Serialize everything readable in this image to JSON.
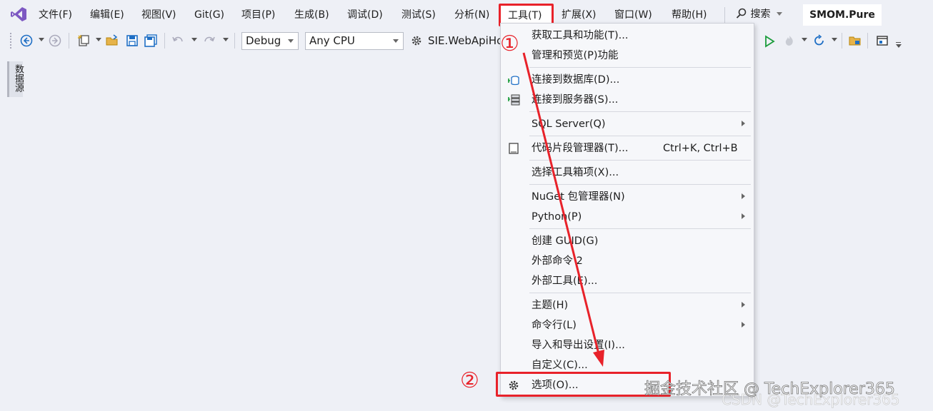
{
  "menubar": {
    "items": [
      "文件(F)",
      "编辑(E)",
      "视图(V)",
      "Git(G)",
      "项目(P)",
      "生成(B)",
      "调试(D)",
      "测试(S)",
      "分析(N)",
      "工具(T)",
      "扩展(X)",
      "窗口(W)",
      "帮助(H)"
    ],
    "search_label": "搜索",
    "solution_name": "SMOM.Pure"
  },
  "toolbar": {
    "configuration": "Debug",
    "platform": "Any CPU",
    "startup_project": "SIE.WebApiHost"
  },
  "side_panel": {
    "tab_label": "数据源"
  },
  "tools_menu": {
    "items": [
      {
        "label": "获取工具和功能(T)...",
        "shortcut": "",
        "submenu": false,
        "icon": ""
      },
      {
        "label": "管理和预览(P)功能",
        "shortcut": "",
        "submenu": false,
        "icon": ""
      },
      {
        "label": "连接到数据库(D)...",
        "shortcut": "",
        "submenu": false,
        "icon": "database-connect-icon"
      },
      {
        "label": "连接到服务器(S)...",
        "shortcut": "",
        "submenu": false,
        "icon": "server-connect-icon"
      },
      {
        "label": "SQL Server(Q)",
        "shortcut": "",
        "submenu": true,
        "icon": ""
      },
      {
        "label": "代码片段管理器(T)...",
        "shortcut": "Ctrl+K, Ctrl+B",
        "submenu": false,
        "icon": "snippet-manager-icon"
      },
      {
        "label": "选择工具箱项(X)...",
        "shortcut": "",
        "submenu": false,
        "icon": ""
      },
      {
        "label": "NuGet 包管理器(N)",
        "shortcut": "",
        "submenu": true,
        "icon": ""
      },
      {
        "label": "Python(P)",
        "shortcut": "",
        "submenu": true,
        "icon": ""
      },
      {
        "label": "创建 GUID(G)",
        "shortcut": "",
        "submenu": false,
        "icon": ""
      },
      {
        "label": "外部命令 2",
        "shortcut": "",
        "submenu": false,
        "icon": ""
      },
      {
        "label": "外部工具(E)...",
        "shortcut": "",
        "submenu": false,
        "icon": ""
      },
      {
        "label": "主题(H)",
        "shortcut": "",
        "submenu": true,
        "icon": ""
      },
      {
        "label": "命令行(L)",
        "shortcut": "",
        "submenu": true,
        "icon": ""
      },
      {
        "label": "导入和导出设置(I)...",
        "shortcut": "",
        "submenu": false,
        "icon": ""
      },
      {
        "label": "自定义(C)...",
        "shortcut": "",
        "submenu": false,
        "icon": ""
      },
      {
        "label": "选项(O)...",
        "shortcut": "",
        "submenu": false,
        "icon": "gear-icon"
      }
    ]
  },
  "annotations": {
    "step1": "①",
    "step2": "②",
    "color": "#e8222a",
    "watermark": "掘金技术社区 @ TechExplorer365",
    "watermark_faint": "CSDN @TechExplorer365"
  }
}
